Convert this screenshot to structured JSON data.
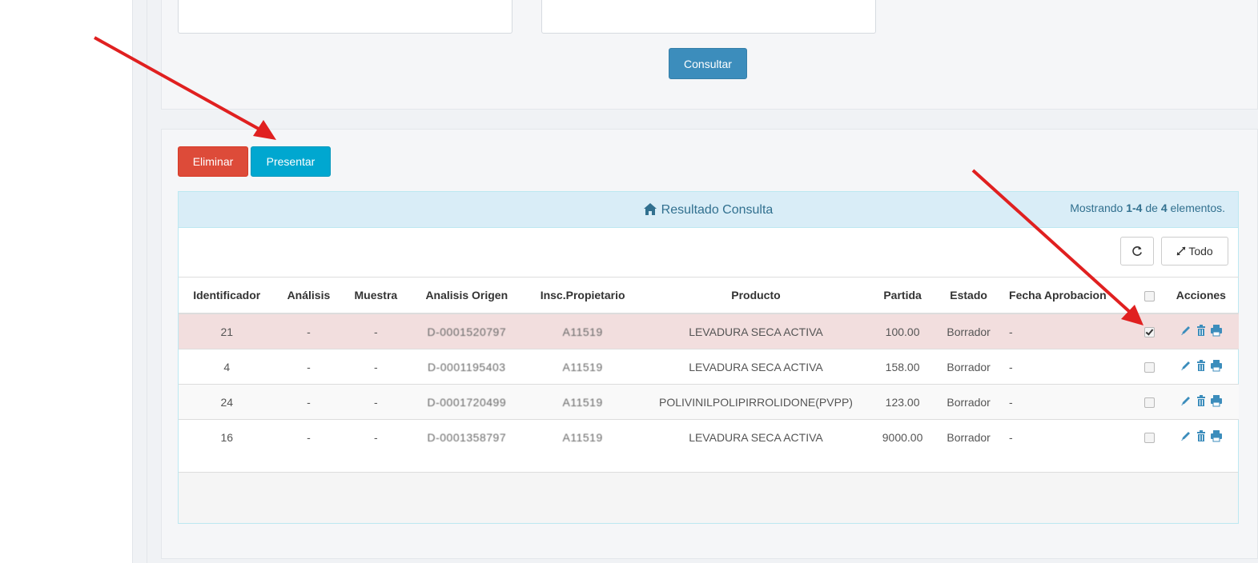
{
  "filters": {
    "consultar_label": "Consultar"
  },
  "actions": {
    "eliminar_label": "Eliminar",
    "presentar_label": "Presentar"
  },
  "panel": {
    "title": "Resultado Consulta",
    "summary_prefix": "Mostrando ",
    "summary_range": "1-4",
    "summary_mid": " de ",
    "summary_total": "4",
    "summary_suffix": " elementos.",
    "refresh_icon": "refresh-icon",
    "todo_label": "Todo"
  },
  "table": {
    "headers": [
      "Identificador",
      "Análisis",
      "Muestra",
      "Analisis Origen",
      "Insc.Propietario",
      "Producto",
      "Partida",
      "Estado",
      "Fecha Aprobacion",
      "",
      "Acciones"
    ],
    "rows": [
      {
        "id": "21",
        "analisis": "-",
        "muestra": "-",
        "origen": "D-0001520797",
        "propietario": "A11519",
        "producto": "LEVADURA SECA ACTIVA",
        "partida": "100.00",
        "estado": "Borrador",
        "fecha": "-",
        "checked": true
      },
      {
        "id": "4",
        "analisis": "-",
        "muestra": "-",
        "origen": "D-0001195403",
        "propietario": "A11519",
        "producto": "LEVADURA SECA ACTIVA",
        "partida": "158.00",
        "estado": "Borrador",
        "fecha": "-",
        "checked": false
      },
      {
        "id": "24",
        "analisis": "-",
        "muestra": "-",
        "origen": "D-0001720499",
        "propietario": "A11519",
        "producto": "POLIVINILPOLIPIRROLIDONE(PVPP)",
        "partida": "123.00",
        "estado": "Borrador",
        "fecha": "-",
        "checked": false
      },
      {
        "id": "16",
        "analisis": "-",
        "muestra": "-",
        "origen": "D-0001358797",
        "propietario": "A11519",
        "producto": "LEVADURA SECA ACTIVA",
        "partida": "9000.00",
        "estado": "Borrador",
        "fecha": "-",
        "checked": false
      }
    ]
  },
  "colors": {
    "danger": "#dd4b39",
    "info": "#00a7d0",
    "primary": "#3c8dbc",
    "annotation_arrow": "#e02020"
  }
}
